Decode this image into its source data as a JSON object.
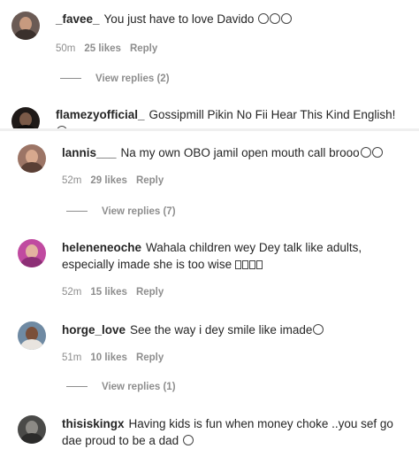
{
  "comments": [
    {
      "username": "_favee_",
      "text": "You just have to love Davido",
      "emoji": "🥹🥹🥹",
      "time": "50m",
      "likes": "25 likes",
      "reply": "Reply",
      "view_replies": "View replies (2)"
    },
    {
      "username": "flamezyofficial_",
      "text": "Gossipmill Pikin No Fii Hear This Kind English!",
      "emoji": "😂"
    },
    {
      "username": "lannis___",
      "text": "Na my own OBO jamil open mouth call brooo",
      "emoji": "😢🥹",
      "time": "52m",
      "likes": "29 likes",
      "reply": "Reply",
      "view_replies": "View replies (7)"
    },
    {
      "username": "heleneneoche",
      "text_line1": "Wahala children wey Dey talk like adults,",
      "text_line2": "especially imade she is too wise",
      "time": "52m",
      "likes": "15 likes",
      "reply": "Reply"
    },
    {
      "username": "horge_love",
      "text": "See the way i dey smile like imade",
      "emoji": "😁",
      "time": "51m",
      "likes": "10 likes",
      "reply": "Reply",
      "view_replies": "View replies (1)"
    },
    {
      "username": "thisiskingx",
      "text_line1": "Having kids is fun when money choke ..you sef go",
      "text_line2": "dae proud to be a dad",
      "emoji": "🙌"
    }
  ]
}
